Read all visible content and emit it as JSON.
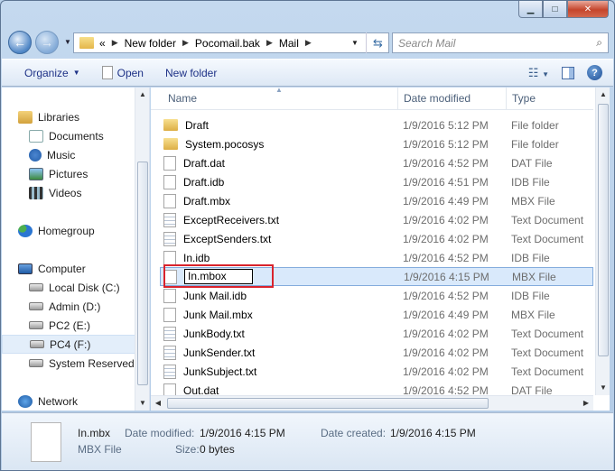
{
  "address": {
    "overflow": "«",
    "crumbs": [
      "New folder",
      "Pocomail.bak",
      "Mail"
    ]
  },
  "search": {
    "placeholder": "Search Mail"
  },
  "toolbar": {
    "organize": "Organize",
    "open": "Open",
    "new_folder": "New folder"
  },
  "nav": {
    "items": [
      {
        "label": "Libraries",
        "icon": "library-icon"
      },
      {
        "label": "Documents",
        "icon": "documents-icon"
      },
      {
        "label": "Music",
        "icon": "music-icon"
      },
      {
        "label": "Pictures",
        "icon": "pictures-icon"
      },
      {
        "label": "Videos",
        "icon": "videos-icon"
      },
      {
        "label": "Homegroup",
        "icon": "homegroup-icon"
      },
      {
        "label": "Computer",
        "icon": "computer-icon"
      },
      {
        "label": "Local Disk (C:)",
        "icon": "local-disk-icon"
      },
      {
        "label": "Admin (D:)",
        "icon": "drive-icon"
      },
      {
        "label": "PC2 (E:)",
        "icon": "drive-icon"
      },
      {
        "label": "PC4 (F:)",
        "icon": "drive-icon",
        "selected": true
      },
      {
        "label": "System Reserved",
        "icon": "drive-icon"
      },
      {
        "label": "Network",
        "icon": "network-icon"
      }
    ]
  },
  "columns": {
    "name": "Name",
    "date": "Date modified",
    "type": "Type"
  },
  "files": [
    {
      "name": "Draft",
      "date": "1/9/2016 5:12 PM",
      "type": "File folder",
      "kind": "folder"
    },
    {
      "name": "System.pocosys",
      "date": "1/9/2016 5:12 PM",
      "type": "File folder",
      "kind": "folder"
    },
    {
      "name": "Draft.dat",
      "date": "1/9/2016 4:52 PM",
      "type": "DAT File",
      "kind": "file"
    },
    {
      "name": "Draft.idb",
      "date": "1/9/2016 4:51 PM",
      "type": "IDB File",
      "kind": "file"
    },
    {
      "name": "Draft.mbx",
      "date": "1/9/2016 4:49 PM",
      "type": "MBX File",
      "kind": "file"
    },
    {
      "name": "ExceptReceivers.txt",
      "date": "1/9/2016 4:02 PM",
      "type": "Text Document",
      "kind": "txt"
    },
    {
      "name": "ExceptSenders.txt",
      "date": "1/9/2016 4:02 PM",
      "type": "Text Document",
      "kind": "txt"
    },
    {
      "name": "In.idb",
      "date": "1/9/2016 4:52 PM",
      "type": "IDB File",
      "kind": "file"
    },
    {
      "name": "In.mbox",
      "date": "1/9/2016 4:15 PM",
      "type": "MBX File",
      "kind": "file",
      "renaming": true
    },
    {
      "name": "Junk Mail.idb",
      "date": "1/9/2016 4:52 PM",
      "type": "IDB File",
      "kind": "file"
    },
    {
      "name": "Junk Mail.mbx",
      "date": "1/9/2016 4:49 PM",
      "type": "MBX File",
      "kind": "file"
    },
    {
      "name": "JunkBody.txt",
      "date": "1/9/2016 4:02 PM",
      "type": "Text Document",
      "kind": "txt"
    },
    {
      "name": "JunkSender.txt",
      "date": "1/9/2016 4:02 PM",
      "type": "Text Document",
      "kind": "txt"
    },
    {
      "name": "JunkSubject.txt",
      "date": "1/9/2016 4:02 PM",
      "type": "Text Document",
      "kind": "txt"
    },
    {
      "name": "Out.dat",
      "date": "1/9/2016 4:52 PM",
      "type": "DAT File",
      "kind": "file"
    }
  ],
  "details": {
    "filename": "In.mbx",
    "filetype": "MBX File",
    "modified_label": "Date modified:",
    "modified_value": "1/9/2016 4:15 PM",
    "created_label": "Date created:",
    "created_value": "1/9/2016 4:15 PM",
    "size_label": "Size:",
    "size_value": "0 bytes"
  },
  "colors": {
    "highlight": "#d9232c",
    "selection": "#d9e9fb",
    "link": "#1e3287"
  }
}
